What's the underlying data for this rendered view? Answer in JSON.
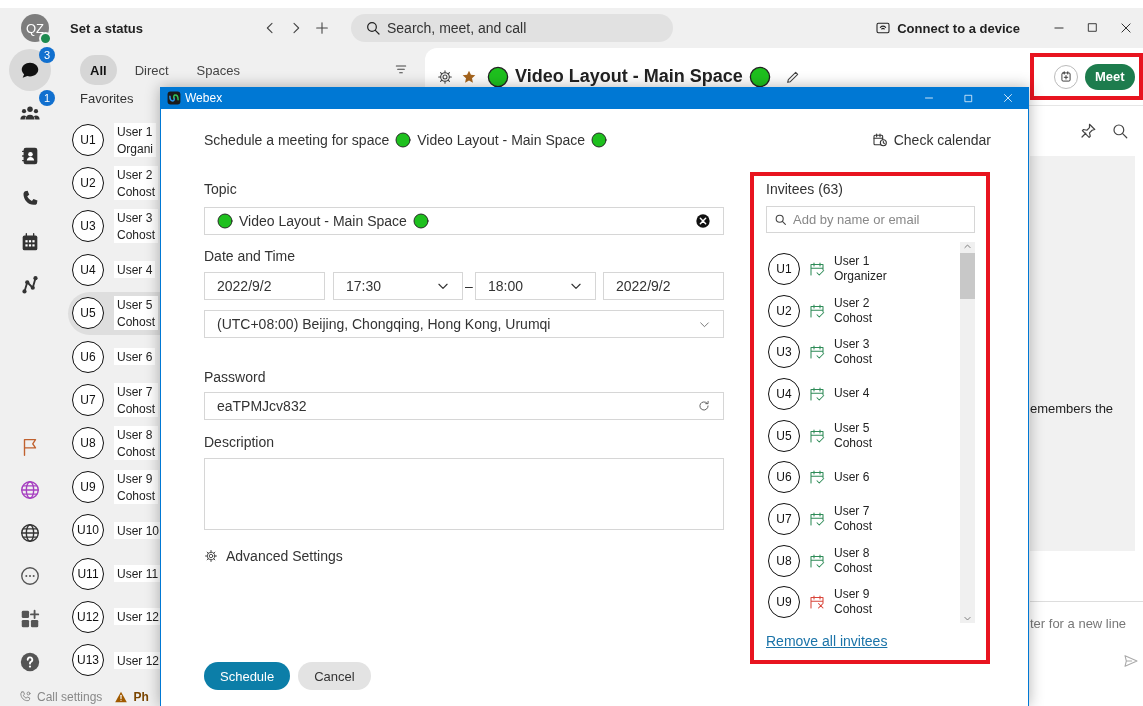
{
  "topbar": {
    "avatar": "QZ",
    "status": "Set a status",
    "search_placeholder": "Search, meet, and call",
    "connect_button": "Connect to a device"
  },
  "rail": {
    "top": [
      {
        "kind": "messaging",
        "badge": "3",
        "selected": true
      },
      {
        "kind": "teams",
        "badge": "1",
        "selected": false
      },
      {
        "kind": "contacts",
        "selected": false
      },
      {
        "kind": "calling",
        "selected": false
      },
      {
        "kind": "meetings",
        "selected": false
      },
      {
        "kind": "workflow",
        "selected": false
      }
    ],
    "bottom": [
      {
        "kind": "flag",
        "selected": false
      },
      {
        "kind": "web-accent",
        "selected": false
      },
      {
        "kind": "web",
        "selected": false
      },
      {
        "kind": "more",
        "selected": false
      },
      {
        "kind": "apps",
        "selected": false
      },
      {
        "kind": "help",
        "selected": false
      }
    ]
  },
  "chat_list": {
    "filters": [
      {
        "label": "All",
        "selected": true
      },
      {
        "label": "Direct",
        "selected": false
      },
      {
        "label": "Spaces",
        "selected": false
      }
    ],
    "section": "Favorites",
    "items": [
      {
        "initials": "U1",
        "name": "User 1",
        "role": "Organi",
        "selected": false
      },
      {
        "initials": "U2",
        "name": "User 2",
        "role": "Cohost",
        "selected": false
      },
      {
        "initials": "U3",
        "name": "User 3",
        "role": "Cohost",
        "selected": false
      },
      {
        "initials": "U4",
        "name": "User 4",
        "selected": false
      },
      {
        "initials": "U5",
        "name": "User 5",
        "role": "Cohost",
        "selected": true
      },
      {
        "initials": "U6",
        "name": "User 6",
        "selected": false
      },
      {
        "initials": "U7",
        "name": "User 7",
        "role": "Cohost",
        "selected": false
      },
      {
        "initials": "U8",
        "name": "User 8",
        "role": "Cohost",
        "selected": false
      },
      {
        "initials": "U9",
        "name": "User 9",
        "role": "Cohost",
        "selected": false
      },
      {
        "initials": "U10",
        "name": "User 10",
        "selected": false
      },
      {
        "initials": "U11",
        "name": "User 11",
        "selected": false
      },
      {
        "initials": "U12",
        "name": "User 12",
        "selected": false
      },
      {
        "initials": "U13",
        "name": "User 12",
        "selected": false
      }
    ]
  },
  "footer": [
    {
      "kind": "call-settings",
      "label": "Call settings"
    },
    {
      "kind": "warning",
      "label": "Ph"
    }
  ],
  "main": {
    "title": "Video Layout - Main Space",
    "highlighted": true,
    "meet_button": "Meet",
    "message_text": "emembers the",
    "composer_text": "ter for a new line"
  },
  "dialog": {
    "title": "Webex",
    "heading": "Schedule a meeting for space",
    "space_name": "Video Layout - Main Space",
    "check_calendar": "Check calendar",
    "topic_label": "Topic",
    "topic": "Video Layout - Main Space",
    "date_label": "Date and Time",
    "start_date": "2022/9/2",
    "start_time": "17:30",
    "range_separator": "–",
    "end_time": "18:00",
    "end_date": "2022/9/2",
    "timezone": "(UTC+08:00) Beijing, Chongqing, Hong Kong, Urumqi",
    "password_label": "Password",
    "password": "eaTPMJcv832",
    "description_label": "Description",
    "advanced_settings": "Advanced Settings",
    "schedule_button": "Schedule",
    "cancel_button": "Cancel",
    "invitees": {
      "title": "Invitees (63)",
      "highlighted": true,
      "search_placeholder": "Add by name or email",
      "remove_all": "Remove all invitees",
      "items": [
        {
          "initials": "U1",
          "name": "User 1",
          "role": "Organizer",
          "accepted": true
        },
        {
          "initials": "U2",
          "name": "User 2",
          "role": "Cohost",
          "accepted": true
        },
        {
          "initials": "U3",
          "name": "User 3",
          "role": "Cohost",
          "accepted": true
        },
        {
          "initials": "U4",
          "name": "User 4",
          "accepted": true
        },
        {
          "initials": "U5",
          "name": "User 5",
          "role": "Cohost",
          "accepted": true
        },
        {
          "initials": "U6",
          "name": "User 6",
          "accepted": true
        },
        {
          "initials": "U7",
          "name": "User 7",
          "role": "Cohost",
          "accepted": true
        },
        {
          "initials": "U8",
          "name": "User 8",
          "role": "Cohost",
          "accepted": true
        },
        {
          "initials": "U9",
          "name": "User 9",
          "role": "Cohost",
          "accepted": false
        }
      ]
    }
  }
}
